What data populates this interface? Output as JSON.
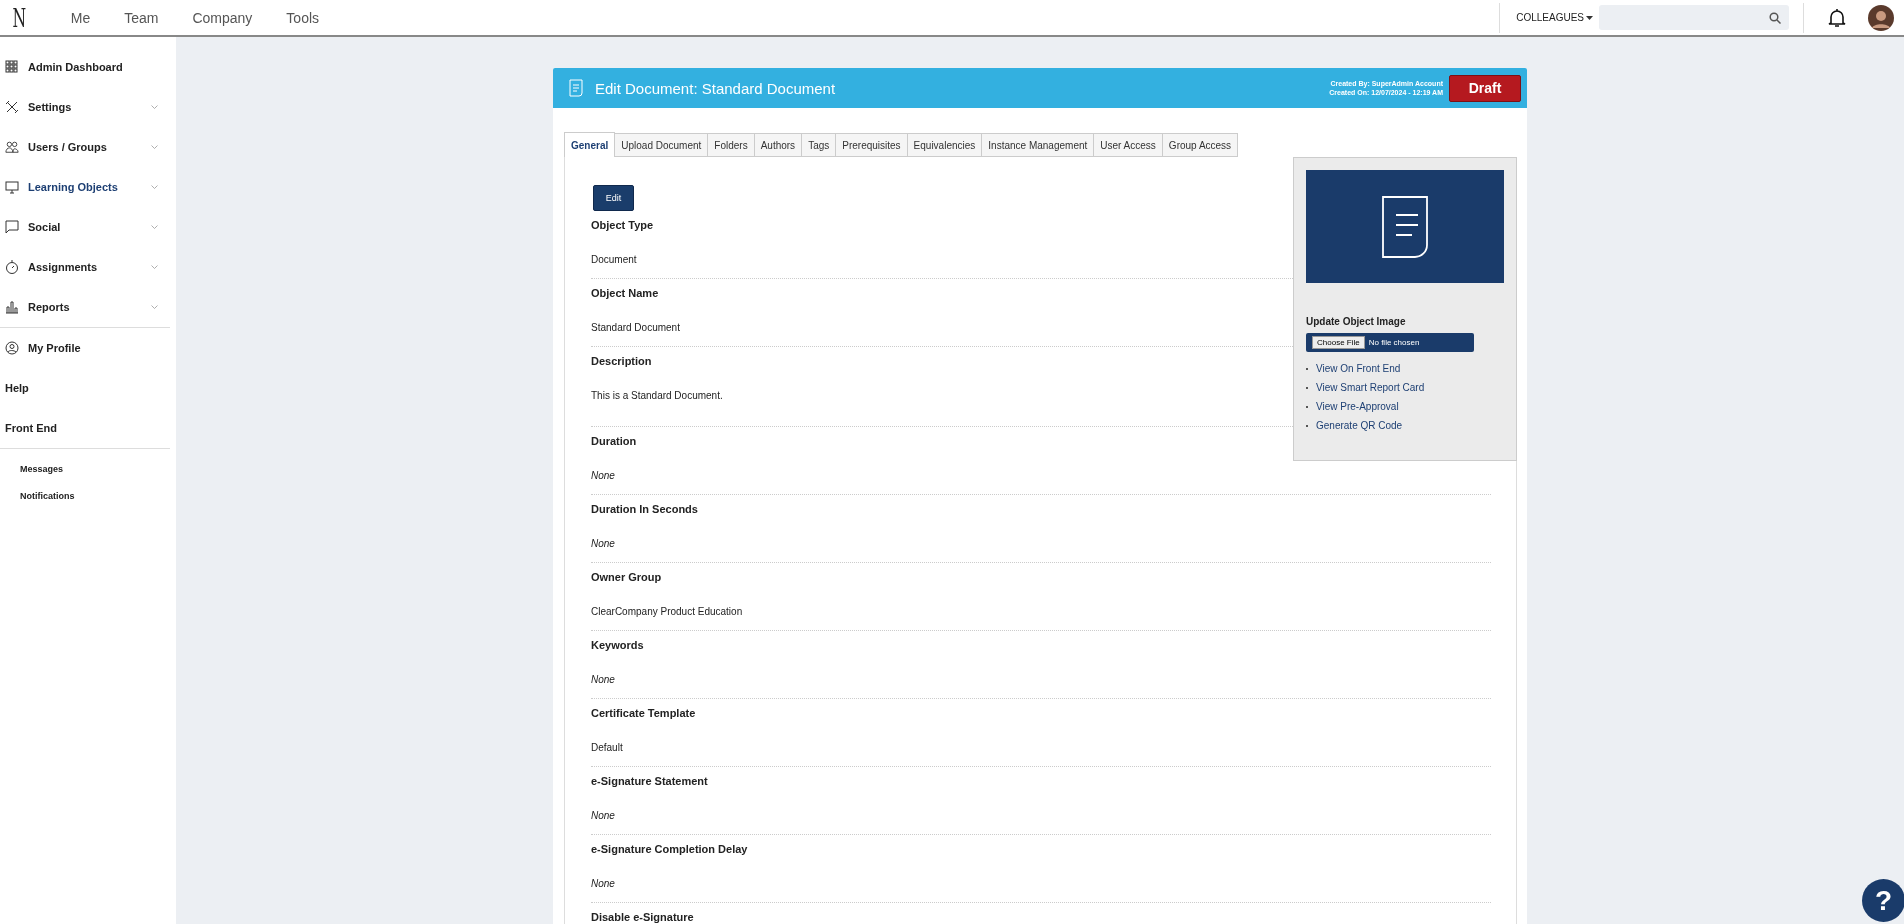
{
  "topbar": {
    "logo": "N",
    "nav": [
      {
        "label": "Me"
      },
      {
        "label": "Team"
      },
      {
        "label": "Company"
      },
      {
        "label": "Tools"
      }
    ],
    "colleagues": "COLLEAGUES"
  },
  "sidebar": {
    "groups": [
      {
        "kind": "main",
        "items": [
          {
            "label": "Admin Dashboard",
            "expandable": false,
            "selected": false
          },
          {
            "label": "Settings",
            "expandable": true,
            "selected": false
          },
          {
            "label": "Users / Groups",
            "expandable": true,
            "selected": false
          },
          {
            "label": "Learning Objects",
            "expandable": true,
            "selected": true
          },
          {
            "label": "Social",
            "expandable": true,
            "selected": false
          },
          {
            "label": "Assignments",
            "expandable": true,
            "selected": false
          },
          {
            "label": "Reports",
            "expandable": true,
            "selected": false
          }
        ]
      },
      {
        "kind": "main",
        "items": [
          {
            "label": "My Profile",
            "expandable": false,
            "selected": false
          },
          {
            "label": "Help",
            "expandable": false,
            "selected": false
          },
          {
            "label": "Front End",
            "expandable": false,
            "selected": false
          }
        ]
      },
      {
        "kind": "sub",
        "items": [
          {
            "label": "Messages",
            "expandable": false,
            "selected": false
          },
          {
            "label": "Notifications",
            "expandable": false,
            "selected": false
          }
        ]
      }
    ]
  },
  "card": {
    "title": "Edit Document: Standard Document",
    "created_by": "Created By: SuperAdmin Account",
    "created_on": "Created On: 12/07/2024 - 12:19 AM",
    "status": "Draft",
    "tabs": [
      {
        "label": "General",
        "selected": true
      },
      {
        "label": "Upload Document",
        "selected": false
      },
      {
        "label": "Folders",
        "selected": false
      },
      {
        "label": "Authors",
        "selected": false
      },
      {
        "label": "Tags",
        "selected": false
      },
      {
        "label": "Prerequisites",
        "selected": false
      },
      {
        "label": "Equivalencies",
        "selected": false
      },
      {
        "label": "Instance Management",
        "selected": false
      },
      {
        "label": "User Access",
        "selected": false
      },
      {
        "label": "Group Access",
        "selected": false
      }
    ],
    "edit_button": "Edit",
    "fields": [
      {
        "label": "Object Type",
        "value": "Document",
        "empty": false
      },
      {
        "label": "Object Name",
        "value": "Standard Document",
        "empty": false
      },
      {
        "label": "Description",
        "value": "This is a Standard Document.",
        "empty": false
      },
      {
        "label": "Duration",
        "value": "None",
        "empty": true
      },
      {
        "label": "Duration In Seconds",
        "value": "None",
        "empty": true
      },
      {
        "label": "Owner Group",
        "value": "ClearCompany Product Education",
        "empty": false
      },
      {
        "label": "Keywords",
        "value": "None",
        "empty": true
      },
      {
        "label": "Certificate Template",
        "value": "Default",
        "empty": false
      },
      {
        "label": "e-Signature Statement",
        "value": "None",
        "empty": true
      },
      {
        "label": "e-Signature Completion Delay",
        "value": "None",
        "empty": true
      },
      {
        "label": "Disable e-Signature"
      }
    ],
    "side_panel": {
      "image_heading": "Update Object Image",
      "file_button": "Choose File",
      "file_status": "No file chosen",
      "links": [
        "View On Front End",
        "View Smart Report Card",
        "View Pre-Approval",
        "Generate QR Code"
      ]
    }
  },
  "help_button": "?"
}
